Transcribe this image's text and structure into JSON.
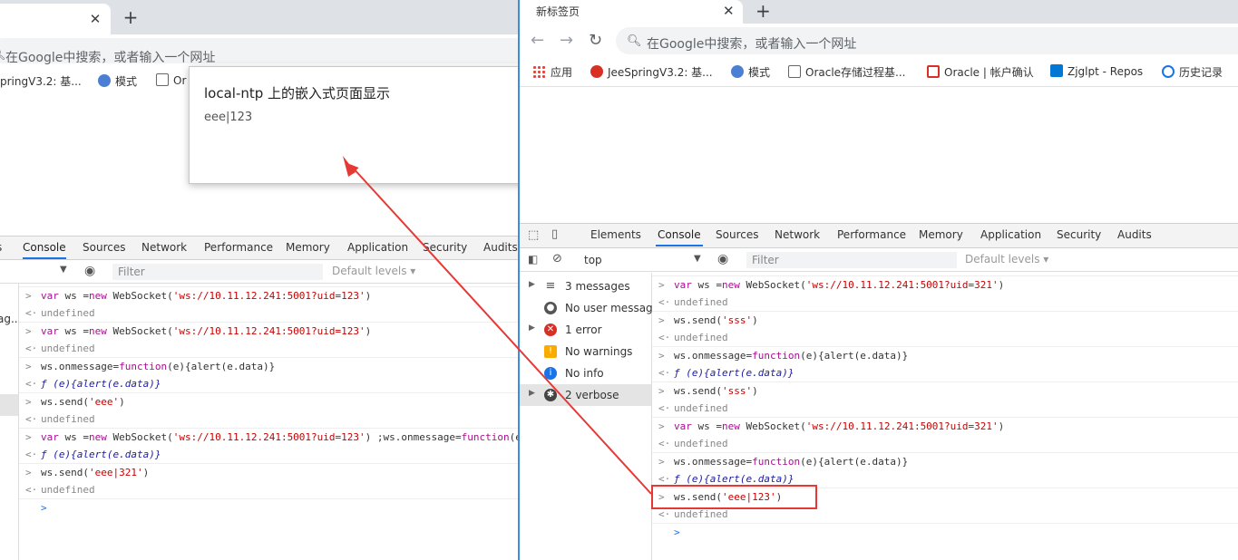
{
  "left": {
    "omnibox_placeholder": "在Google中搜索，或者输入一个网址",
    "bookmarks": [
      "pringV3.2: 基...",
      "模式",
      "Or"
    ],
    "alert": {
      "title": "local-ntp 上的嵌入式页面显示",
      "message": "eee|123"
    },
    "devtools_tabs": [
      "s",
      "Console",
      "Sources",
      "Network",
      "Performance",
      "Memory",
      "Application",
      "Security",
      "Audits"
    ],
    "filter_placeholder": "Filter",
    "default_levels": "Default levels ▾",
    "sidebar_fragment": "ag...",
    "console": [
      {
        "type": "in",
        "parts": [
          [
            "kw",
            "var"
          ],
          [
            "txt",
            " ws "
          ],
          [
            "txt",
            "="
          ],
          [
            "kw",
            "new"
          ],
          [
            "txt",
            " WebSocket("
          ],
          [
            "str",
            "'ws://10.11.12.241:5001?uid=123'"
          ],
          [
            "txt",
            ")"
          ]
        ]
      },
      {
        "type": "out",
        "text": "undefined"
      },
      {
        "type": "in",
        "parts": [
          [
            "kw",
            "var"
          ],
          [
            "txt",
            " ws "
          ],
          [
            "txt",
            "="
          ],
          [
            "kw",
            "new"
          ],
          [
            "txt",
            " WebSocket("
          ],
          [
            "str",
            "'ws://10.11.12.241:5001?uid=123'"
          ],
          [
            "txt",
            ")"
          ]
        ]
      },
      {
        "type": "out",
        "text": "undefined"
      },
      {
        "type": "in",
        "parts": [
          [
            "txt",
            "ws.onmessage="
          ],
          [
            "kw",
            "function"
          ],
          [
            "txt",
            "(e){alert(e.data)}"
          ]
        ]
      },
      {
        "type": "fn",
        "text": "ƒ (e){alert(e.data)}"
      },
      {
        "type": "in",
        "parts": [
          [
            "txt",
            "ws.send("
          ],
          [
            "str",
            "'eee'"
          ],
          [
            "txt",
            ")"
          ]
        ]
      },
      {
        "type": "out",
        "text": "undefined"
      },
      {
        "type": "in",
        "parts": [
          [
            "kw",
            "var"
          ],
          [
            "txt",
            " ws "
          ],
          [
            "txt",
            "="
          ],
          [
            "kw",
            "new"
          ],
          [
            "txt",
            " WebSocket("
          ],
          [
            "str",
            "'ws://10.11.12.241:5001?uid=123'"
          ],
          [
            "txt",
            ") ;ws.onmessage="
          ],
          [
            "kw",
            "function"
          ],
          [
            "txt",
            "(e"
          ]
        ]
      },
      {
        "type": "fn",
        "text": "ƒ (e){alert(e.data)}"
      },
      {
        "type": "in",
        "parts": [
          [
            "txt",
            "ws.send("
          ],
          [
            "str",
            "'eee|321'"
          ],
          [
            "txt",
            ")"
          ]
        ]
      },
      {
        "type": "out",
        "text": "undefined"
      },
      {
        "type": "prompt",
        "text": ">"
      }
    ]
  },
  "right": {
    "tab_title": "新标签页",
    "omnibox_placeholder": "在Google中搜索，或者输入一个网址",
    "bookmarks": [
      "应用",
      "JeeSpringV3.2: 基...",
      "模式",
      "Oracle存储过程基...",
      "Oracle | 帐户确认",
      "Zjglpt - Repos",
      "历史记录"
    ],
    "devtools_tabs": [
      "Elements",
      "Console",
      "Sources",
      "Network",
      "Performance",
      "Memory",
      "Application",
      "Security",
      "Audits"
    ],
    "context": "top",
    "filter_placeholder": "Filter",
    "default_levels": "Default levels ▾",
    "sidebar": [
      {
        "label": "3 messages",
        "icon": "list-icon"
      },
      {
        "label": "No user messag...",
        "icon": "user-icon"
      },
      {
        "label": "1 error",
        "icon": "error-icon"
      },
      {
        "label": "No warnings",
        "icon": "warning-icon"
      },
      {
        "label": "No info",
        "icon": "info-icon"
      },
      {
        "label": "2 verbose",
        "icon": "bug-icon"
      }
    ],
    "console": [
      {
        "type": "in",
        "parts": [
          [
            "kw",
            "var"
          ],
          [
            "txt",
            " ws "
          ],
          [
            "txt",
            "="
          ],
          [
            "kw",
            "new"
          ],
          [
            "txt",
            " WebSocket("
          ],
          [
            "str",
            "'ws://10.11.12.241:5001?uid=321'"
          ],
          [
            "txt",
            ")"
          ]
        ]
      },
      {
        "type": "out",
        "text": "undefined"
      },
      {
        "type": "in",
        "parts": [
          [
            "txt",
            "ws.send("
          ],
          [
            "str",
            "'sss'"
          ],
          [
            "txt",
            ")"
          ]
        ]
      },
      {
        "type": "out",
        "text": "undefined"
      },
      {
        "type": "in",
        "parts": [
          [
            "txt",
            "ws.onmessage="
          ],
          [
            "kw",
            "function"
          ],
          [
            "txt",
            "(e){alert(e.data)}"
          ]
        ]
      },
      {
        "type": "fn",
        "text": "ƒ (e){alert(e.data)}"
      },
      {
        "type": "in",
        "parts": [
          [
            "txt",
            "ws.send("
          ],
          [
            "str",
            "'sss'"
          ],
          [
            "txt",
            ")"
          ]
        ]
      },
      {
        "type": "out",
        "text": "undefined"
      },
      {
        "type": "in",
        "parts": [
          [
            "kw",
            "var"
          ],
          [
            "txt",
            " ws "
          ],
          [
            "txt",
            "="
          ],
          [
            "kw",
            "new"
          ],
          [
            "txt",
            " WebSocket("
          ],
          [
            "str",
            "'ws://10.11.12.241:5001?uid=321'"
          ],
          [
            "txt",
            ")"
          ]
        ]
      },
      {
        "type": "out",
        "text": "undefined"
      },
      {
        "type": "in",
        "parts": [
          [
            "txt",
            "ws.onmessage="
          ],
          [
            "kw",
            "function"
          ],
          [
            "txt",
            "(e){alert(e.data)}"
          ]
        ]
      },
      {
        "type": "fn",
        "text": "ƒ (e){alert(e.data)}"
      },
      {
        "type": "in",
        "parts": [
          [
            "txt",
            "ws.send("
          ],
          [
            "str",
            "'eee|123'"
          ],
          [
            "txt",
            ")"
          ]
        ]
      },
      {
        "type": "out",
        "text": "undefined"
      },
      {
        "type": "prompt",
        "text": ">"
      }
    ]
  },
  "colors": {
    "highlight": "#e53935",
    "accent": "#1a73e8"
  }
}
